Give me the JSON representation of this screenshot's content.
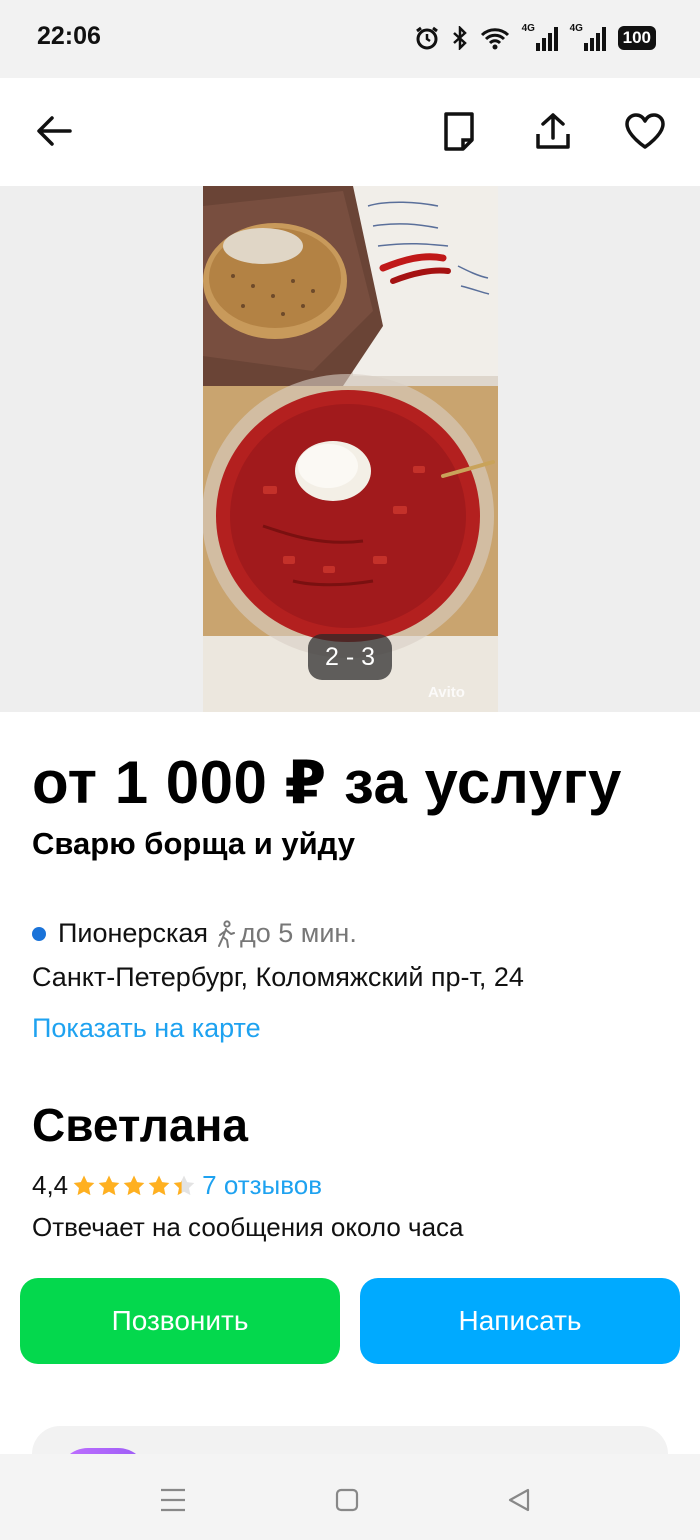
{
  "status_bar": {
    "time": "22:06",
    "network_label_1": "4G",
    "network_label_2": "4G",
    "battery": "100",
    "icons": [
      "alarm-icon",
      "bluetooth-icon",
      "wifi-icon",
      "signal-icon",
      "signal-icon",
      "battery-icon"
    ]
  },
  "header": {
    "icons": [
      "back-arrow-icon",
      "note-icon",
      "share-icon",
      "heart-icon"
    ]
  },
  "gallery": {
    "counter": "2 - 3",
    "watermark": "Avito"
  },
  "listing": {
    "price": "от 1 000 ₽ за услугу",
    "title": "Сварю борща и уйду",
    "metro_station": "Пионерская",
    "metro_walk": "до 5 мин.",
    "address": "Санкт-Петербург, Коломяжский пр-т, 24",
    "map_link": "Показать на карте"
  },
  "seller": {
    "name": "Светлана",
    "rating": "4,4",
    "rating_value": 4.4,
    "rating_max": 5,
    "reviews": "7 отзывов",
    "reply_time": "Отвечает на сообщения около часа"
  },
  "actions": {
    "call": "Позвонить",
    "write": "Написать"
  },
  "colors": {
    "call_button": "#04d84d",
    "write_button": "#00aaff",
    "link": "#1ea2f0",
    "star": "#ffb020",
    "metro_dot": "#1a73d9"
  },
  "nav": {
    "icons": [
      "menu-icon",
      "home-square-icon",
      "back-triangle-icon"
    ]
  }
}
